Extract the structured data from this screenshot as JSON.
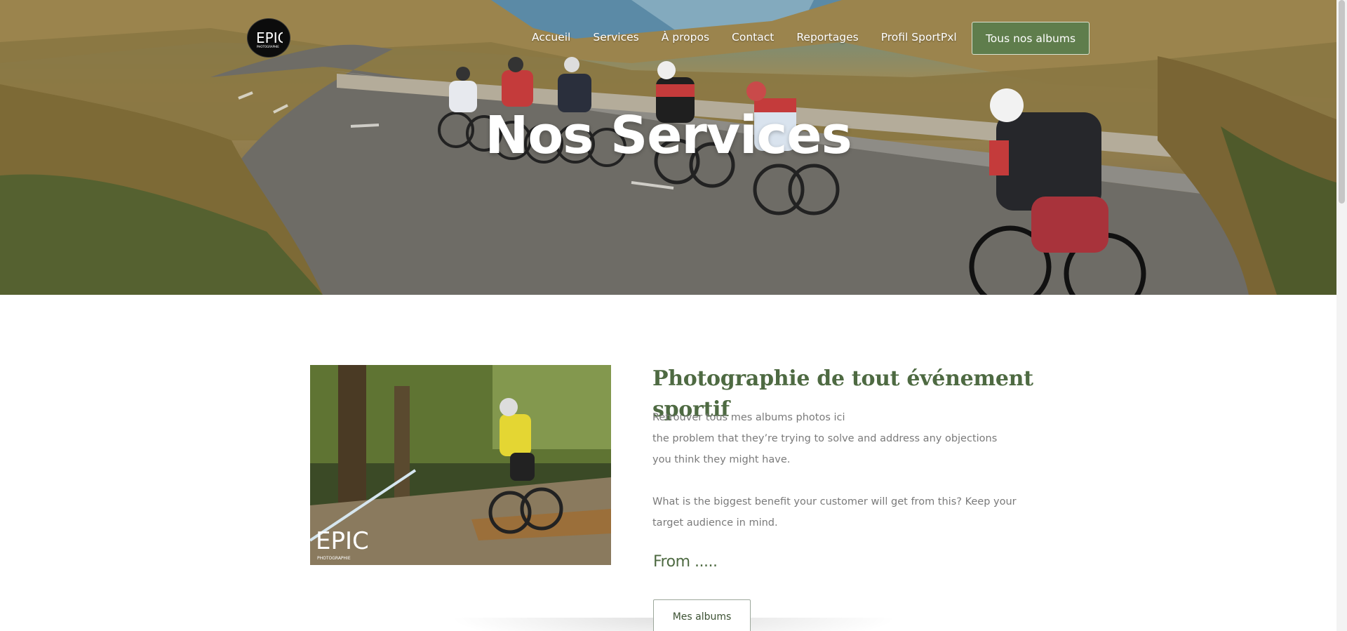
{
  "brand": {
    "logo_text": "EPIC",
    "logo_subtext": "PHOTOGRAPHIE",
    "accent": "#5f7d4c",
    "heading_color": "#4e6a42"
  },
  "nav": {
    "items": [
      {
        "label": "Accueil"
      },
      {
        "label": "Services"
      },
      {
        "label": "À propos"
      },
      {
        "label": "Contact"
      },
      {
        "label": "Reportages"
      },
      {
        "label": "Profil SportPxl"
      }
    ],
    "cta_label": "Tous nos albums"
  },
  "hero": {
    "title": "Nos Services"
  },
  "service": {
    "title": "Photographie de tout événement sportif",
    "description": [
      "Retrouver tous mes albums photos ici",
      "the problem that they’re trying to solve and address any objections",
      "you think they might have.",
      "What is the biggest benefit your customer will get from this? Keep your",
      "target audience in mind."
    ],
    "price": "From .....",
    "button_label": "Mes albums",
    "photo_watermark": "EPIC",
    "photo_watermark_sub": "PHOTOGRAPHIE"
  }
}
